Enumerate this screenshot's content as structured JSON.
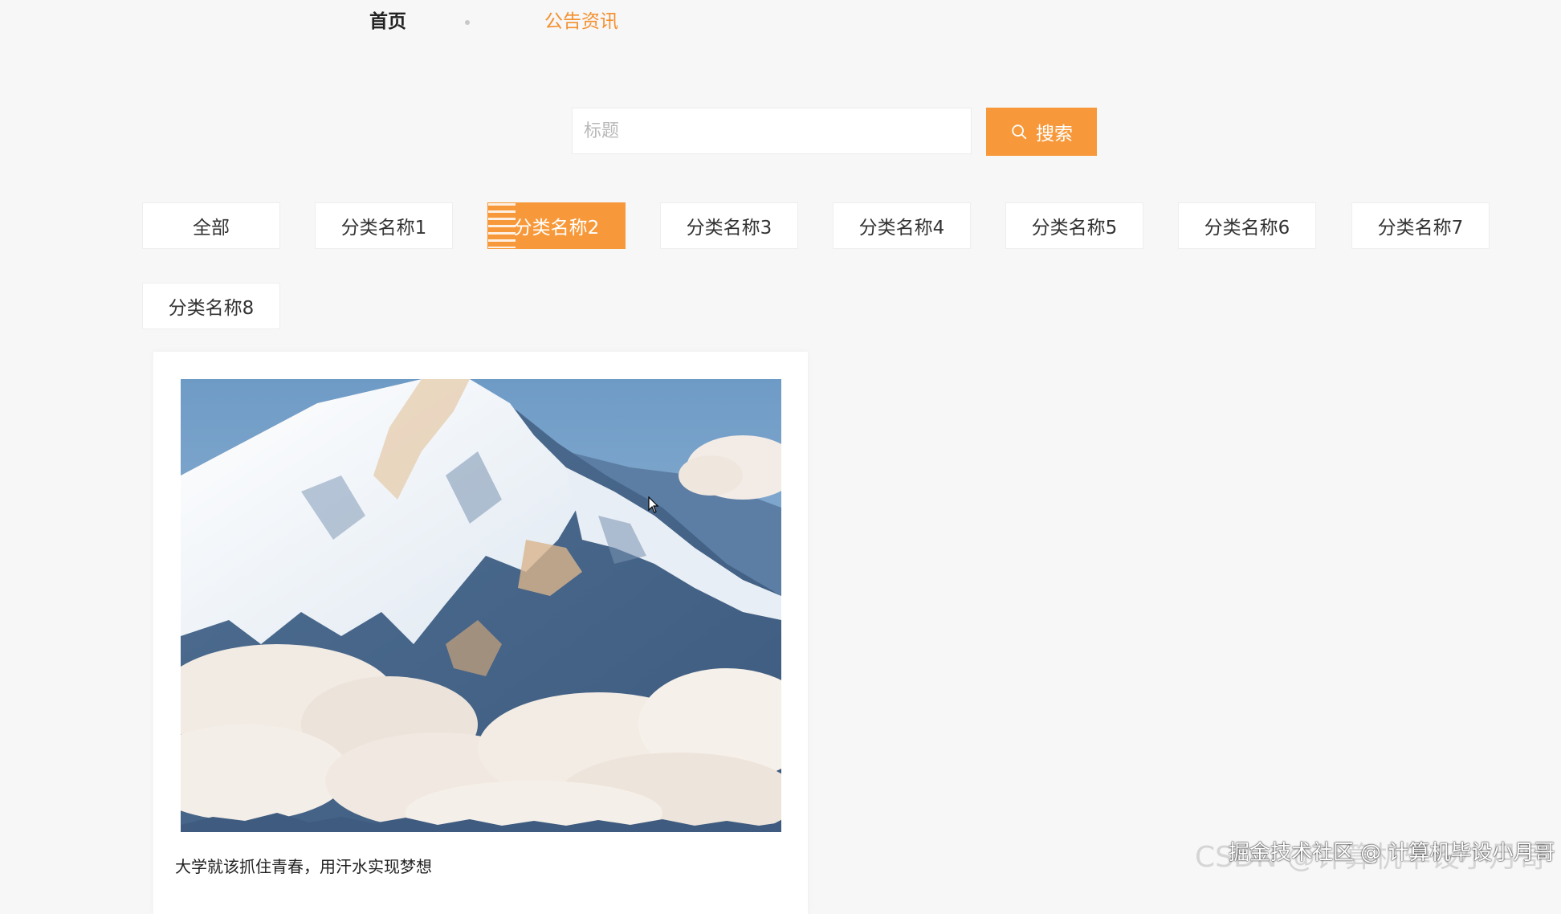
{
  "nav": {
    "home": "首页",
    "notice": "公告资讯"
  },
  "search": {
    "placeholder": "标题",
    "button_label": "搜索"
  },
  "categories": [
    {
      "label": "全部",
      "active": false
    },
    {
      "label": "分类名称1",
      "active": false
    },
    {
      "label": "分类名称2",
      "active": true
    },
    {
      "label": "分类名称3",
      "active": false
    },
    {
      "label": "分类名称4",
      "active": false
    },
    {
      "label": "分类名称5",
      "active": false
    },
    {
      "label": "分类名称6",
      "active": false
    },
    {
      "label": "分类名称7",
      "active": false
    },
    {
      "label": "分类名称8",
      "active": false
    }
  ],
  "articles": [
    {
      "title": "大学就该抓住青春，用汗水实现梦想"
    }
  ],
  "watermark": {
    "primary": "掘金技术社区 @ 计算机毕设小月哥",
    "secondary": "CSDN @计算机毕设小月哥"
  },
  "colors": {
    "accent": "#f7993a",
    "nav_active": "#f3902f",
    "background": "#f7f7f7"
  }
}
